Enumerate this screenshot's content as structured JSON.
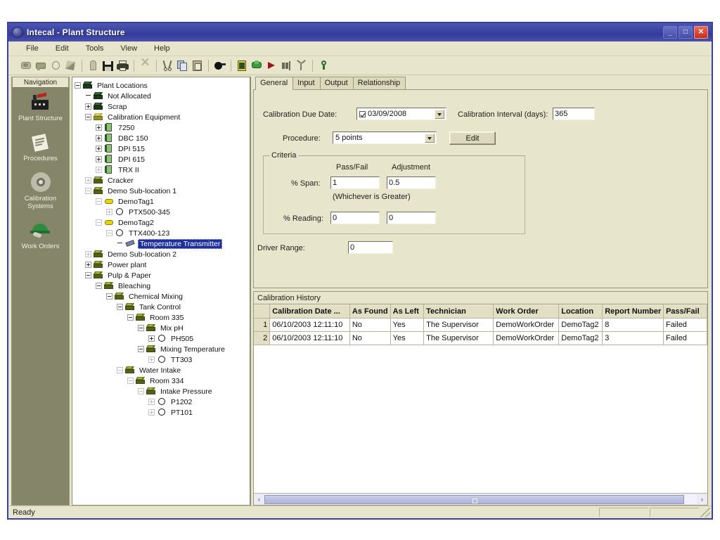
{
  "window": {
    "title": "Intecal - Plant Structure",
    "icon": "app-globe-icon",
    "minimize": "_",
    "maximize": "□",
    "close": "✕"
  },
  "menu": {
    "items": [
      "File",
      "Edit",
      "Tools",
      "View",
      "Help"
    ]
  },
  "toolbar": {
    "icons": [
      {
        "name": "new-plant-icon",
        "group": 1
      },
      {
        "name": "new-location-icon",
        "group": 1
      },
      {
        "name": "new-tag-icon",
        "group": 1
      },
      {
        "name": "new-device-icon",
        "group": 1
      },
      {
        "name": "open-icon",
        "group": 2
      },
      {
        "name": "save-icon",
        "group": 2
      },
      {
        "name": "print-icon",
        "group": 2
      },
      {
        "name": "delete-icon",
        "group": 3
      },
      {
        "name": "cut-icon",
        "group": 4
      },
      {
        "name": "copy-icon",
        "group": 4
      },
      {
        "name": "paste-icon",
        "group": 4
      },
      {
        "name": "find-icon",
        "group": 5
      },
      {
        "name": "calibration-icon",
        "group": 6
      },
      {
        "name": "download-icon",
        "group": 6
      },
      {
        "name": "run-icon",
        "group": 6
      },
      {
        "name": "upload-icon",
        "group": 6
      },
      {
        "name": "branch-icon",
        "group": 6
      },
      {
        "name": "help-icon",
        "group": 7
      }
    ]
  },
  "navigation": {
    "header": "Navigation",
    "items": [
      {
        "label": "Plant Structure",
        "icon": "factory-icon",
        "selected": true
      },
      {
        "label": "Procedures",
        "icon": "clipboard-icon",
        "selected": false
      },
      {
        "label": "Calibration Systems",
        "icon": "gear-icon",
        "selected": false
      },
      {
        "label": "Work Orders",
        "icon": "hardhat-icon",
        "selected": false
      }
    ]
  },
  "tree": {
    "nodes": [
      {
        "label": "Plant Locations",
        "indent": 0,
        "expander": "minus",
        "icon": "box-dark",
        "selected": false
      },
      {
        "label": "Not Allocated",
        "indent": 1,
        "expander": "none",
        "icon": "box-dark",
        "selected": false
      },
      {
        "label": "Scrap",
        "indent": 1,
        "expander": "plus",
        "icon": "box-dark",
        "selected": false
      },
      {
        "label": "Calibration Equipment",
        "indent": 1,
        "expander": "minus",
        "icon": "box-yellow",
        "selected": false
      },
      {
        "label": "7250",
        "indent": 2,
        "expander": "plus",
        "icon": "cal",
        "selected": false
      },
      {
        "label": "DBC 150",
        "indent": 2,
        "expander": "plus",
        "icon": "cal",
        "selected": false
      },
      {
        "label": "DPI 515",
        "indent": 2,
        "expander": "plus",
        "icon": "cal",
        "selected": false
      },
      {
        "label": "DPI 615",
        "indent": 2,
        "expander": "plus",
        "icon": "cal",
        "selected": false
      },
      {
        "label": "TRX II",
        "indent": 2,
        "expander": "plus-dim",
        "icon": "cal",
        "selected": false
      },
      {
        "label": "Cracker",
        "indent": 1,
        "expander": "plus-dim",
        "icon": "box-olive",
        "selected": false
      },
      {
        "label": "Demo Sub-location 1",
        "indent": 1,
        "expander": "minus-dim",
        "icon": "box-olive",
        "selected": false
      },
      {
        "label": "DemoTag1",
        "indent": 2,
        "expander": "minus-dim",
        "icon": "tag",
        "selected": false
      },
      {
        "label": "PTX500-345",
        "indent": 3,
        "expander": "plus-dim",
        "icon": "dev",
        "selected": false
      },
      {
        "label": "DemoTag2",
        "indent": 2,
        "expander": "minus-dim",
        "icon": "tag",
        "selected": false
      },
      {
        "label": "TTX400-123",
        "indent": 3,
        "expander": "minus-dim",
        "icon": "dev",
        "selected": false
      },
      {
        "label": "Temperature Transmitter",
        "indent": 4,
        "expander": "none",
        "icon": "tx",
        "selected": true
      },
      {
        "label": "Demo Sub-location 2",
        "indent": 1,
        "expander": "plus-dim",
        "icon": "box-olive",
        "selected": false
      },
      {
        "label": "Power plant",
        "indent": 1,
        "expander": "plus",
        "icon": "box-olive",
        "selected": false
      },
      {
        "label": "Pulp & Paper",
        "indent": 1,
        "expander": "minus",
        "icon": "box-olive",
        "selected": false
      },
      {
        "label": "Bleaching",
        "indent": 2,
        "expander": "minus",
        "icon": "box-olive",
        "selected": false
      },
      {
        "label": "Chemical Mixing",
        "indent": 3,
        "expander": "minus",
        "icon": "box-olive",
        "selected": false
      },
      {
        "label": "Tank Control",
        "indent": 4,
        "expander": "minus",
        "icon": "box-olive",
        "selected": false
      },
      {
        "label": "Room 335",
        "indent": 5,
        "expander": "minus",
        "icon": "box-olive",
        "selected": false
      },
      {
        "label": "Mix pH",
        "indent": 6,
        "expander": "minus",
        "icon": "box-olive",
        "selected": false
      },
      {
        "label": "PH505",
        "indent": 7,
        "expander": "plus",
        "icon": "dev",
        "selected": false
      },
      {
        "label": "Mixing Temperature",
        "indent": 6,
        "expander": "minus",
        "icon": "box-olive",
        "selected": false
      },
      {
        "label": "TT303",
        "indent": 7,
        "expander": "plus-dim",
        "icon": "dev",
        "selected": false
      },
      {
        "label": "Water Intake",
        "indent": 4,
        "expander": "minus-dim",
        "icon": "box-olive",
        "selected": false
      },
      {
        "label": "Room 334",
        "indent": 5,
        "expander": "minus-dim",
        "icon": "box-olive",
        "selected": false
      },
      {
        "label": "Intake Pressure",
        "indent": 6,
        "expander": "minus-dim",
        "icon": "box-olive",
        "selected": false
      },
      {
        "label": "P1202",
        "indent": 7,
        "expander": "plus-dim",
        "icon": "dev",
        "selected": false
      },
      {
        "label": "PT101",
        "indent": 7,
        "expander": "plus-dim",
        "icon": "dev",
        "selected": false
      }
    ]
  },
  "tabs": [
    {
      "label": "General",
      "active": true
    },
    {
      "label": "Input",
      "active": false
    },
    {
      "label": "Output",
      "active": false
    },
    {
      "label": "Relationship",
      "active": false
    }
  ],
  "general": {
    "due_date_label": "Calibration Due Date:",
    "due_date_value": "03/09/2008",
    "due_date_enabled": true,
    "interval_label": "Calibration Interval (days):",
    "interval_value": "365",
    "procedure_label": "Procedure:",
    "procedure_value": "5 points",
    "edit_button": "Edit",
    "criteria": {
      "title": "Criteria",
      "col_passfail": "Pass/Fail",
      "col_adjustment": "Adjustment",
      "row_span": "% Span:",
      "span_passfail": "1",
      "span_adjustment": "0.5",
      "note": "(Whichever is Greater)",
      "row_reading": "% Reading:",
      "reading_passfail": "0",
      "reading_adjustment": "0"
    },
    "driver_range_label": "Driver Range:",
    "driver_range_value": "0"
  },
  "history": {
    "title": "Calibration History",
    "columns": [
      "",
      "Calibration Date ...",
      "As Found",
      "As Left",
      "Technician",
      "Work Order",
      "Location",
      "Report Number",
      "Pass/Fail"
    ],
    "rows": [
      [
        "1",
        "06/10/2003 12:11:10",
        "No",
        "Yes",
        "The Supervisor",
        "DemoWorkOrder",
        "DemoTag2",
        "8",
        "Failed"
      ],
      [
        "2",
        "06/10/2003 12:11:10",
        "No",
        "Yes",
        "The Supervisor",
        "DemoWorkOrder",
        "DemoTag2",
        "3",
        "Failed"
      ]
    ],
    "scroll_left": "‹",
    "scroll_right": "›"
  },
  "statusbar": {
    "message": "Ready"
  },
  "colors": {
    "titlebar": "#3b42a0",
    "panel": "#e8e5cd",
    "navigation": "#85856a",
    "selection": "#1c2f9a",
    "grid_header": "#e2dfc4"
  }
}
